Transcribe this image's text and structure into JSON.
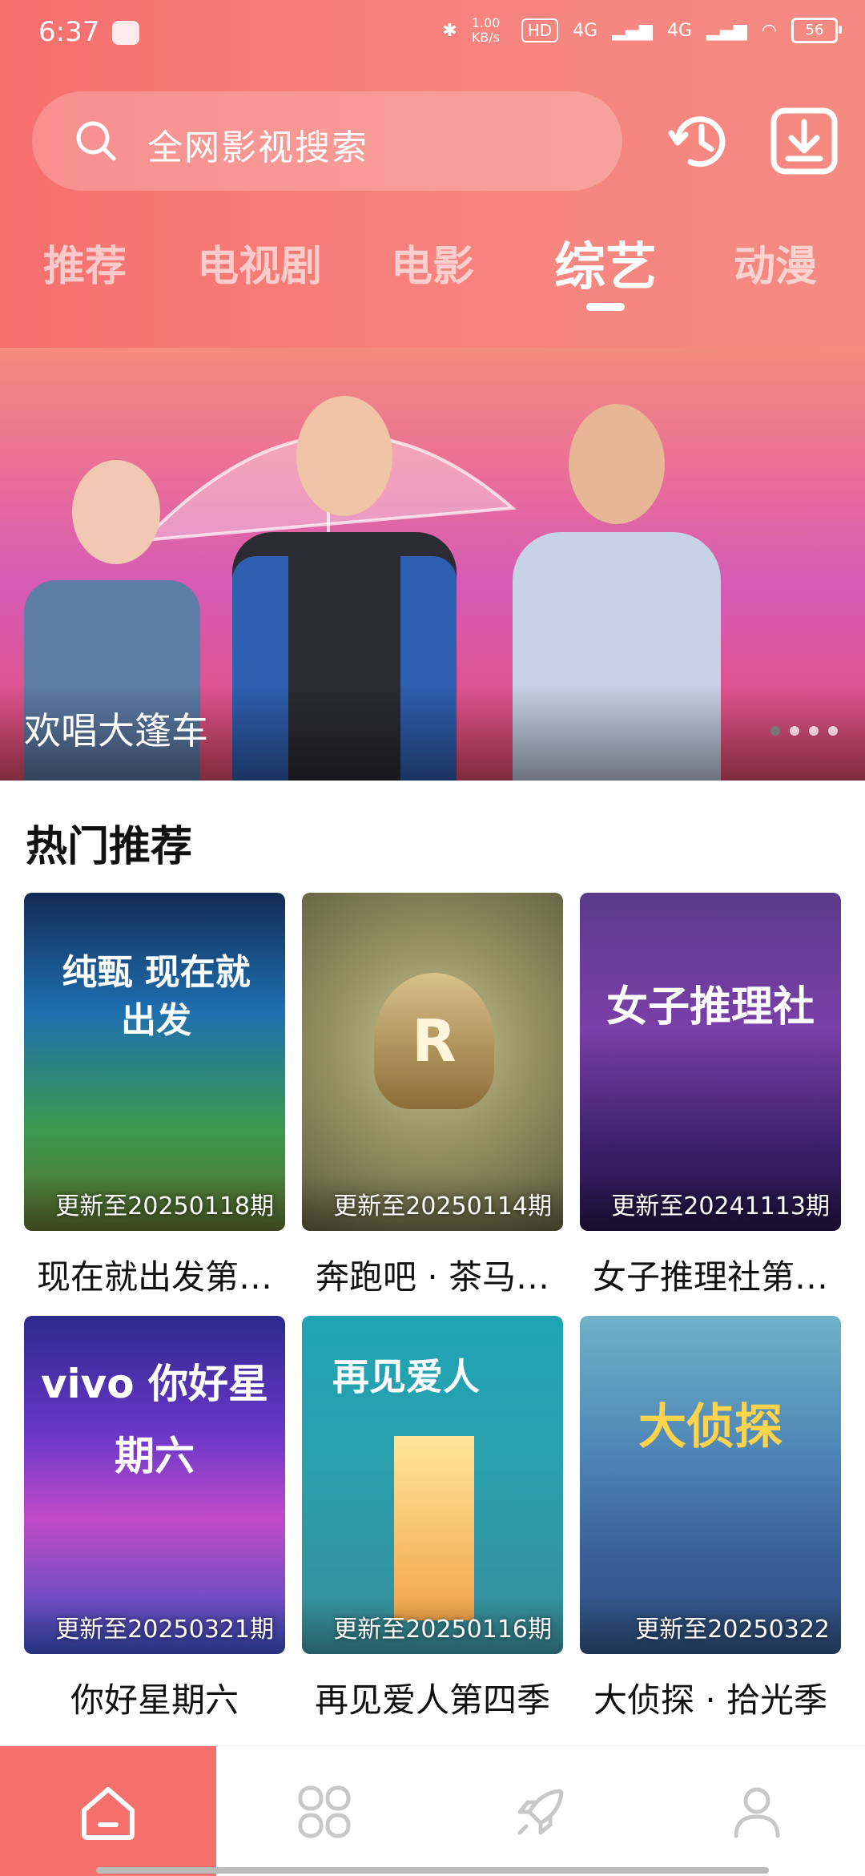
{
  "status_bar": {
    "time": "6:37",
    "net_speed": "1.00 KB/s",
    "hd": "HD",
    "signal1": "4G",
    "signal2": "4G",
    "battery": "56"
  },
  "search": {
    "placeholder": "全网影视搜索"
  },
  "tabs": [
    {
      "label": "推荐"
    },
    {
      "label": "电视剧"
    },
    {
      "label": "电影"
    },
    {
      "label": "综艺"
    },
    {
      "label": "动漫"
    }
  ],
  "banner": {
    "caption": "欢唱大篷车"
  },
  "section": {
    "title": "热门推荐"
  },
  "cards": [
    {
      "title": "现在就出发第…",
      "update": "更新至20250118期",
      "poster_text": "纯甄 现在就出发"
    },
    {
      "title": "奔跑吧 · 茶马…",
      "update": "更新至20250114期",
      "poster_text": "R"
    },
    {
      "title": "女子推理社第…",
      "update": "更新至20241113期",
      "poster_text": "女子推理社"
    },
    {
      "title": "你好星期六",
      "update": "更新至20250321期",
      "poster_text": "vivo 你好星期六"
    },
    {
      "title": "再见爱人第四季",
      "update": "更新至20250116期",
      "poster_text": "再见爱人"
    },
    {
      "title": "大侦探 · 拾光季",
      "update": "更新至20250322",
      "poster_text": "大侦探"
    }
  ],
  "nav": [
    {
      "icon": "home-icon"
    },
    {
      "icon": "category-icon"
    },
    {
      "icon": "rocket-icon"
    },
    {
      "icon": "profile-icon"
    }
  ],
  "colors": {
    "accent": "#f56f6d"
  }
}
